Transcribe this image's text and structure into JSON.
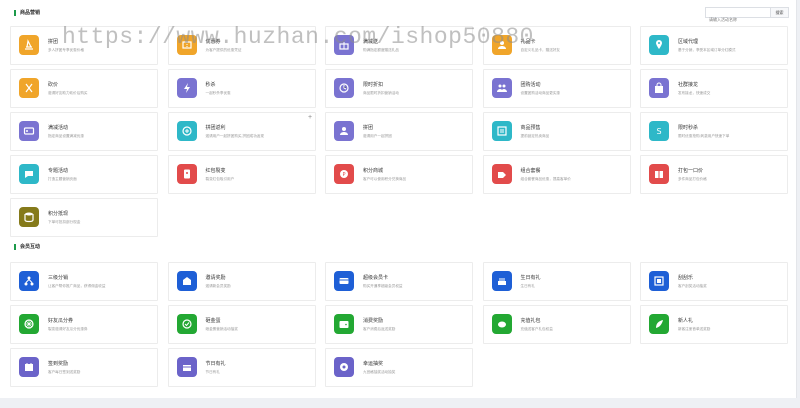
{
  "sections": {
    "marketing_title": "商品营销",
    "member_title": "会员互动"
  },
  "search": {
    "placeholder": "请输入活动名称",
    "button_label": "搜索"
  },
  "watermark": "https://www.huzhan.com/ishop50880",
  "marketing_items": [
    {
      "name": "拼团",
      "desc": "多人拼团专享优惠价格",
      "color": "#f0a52a",
      "icon": "stack-icon"
    },
    {
      "name": "优惠券",
      "desc": "为客户提供的优惠凭证",
      "color": "#f0a52a",
      "icon": "coupon-icon"
    },
    {
      "name": "满减送",
      "desc": "购满指定额度赠送礼品",
      "color": "#7a73d1",
      "icon": "gift-icon"
    },
    {
      "name": "礼品卡",
      "desc": "自定义礼品卡，赠送好友",
      "color": "#f0a52a",
      "icon": "card-icon"
    },
    {
      "name": "区域代理",
      "desc": "基于分销，享受本区域订单分红模式",
      "color": "#2eb8c8",
      "icon": "location-icon"
    },
    {
      "name": "砍价",
      "desc": "邀请好友助力砍价后购买",
      "color": "#f0a52a",
      "icon": "cut-icon"
    },
    {
      "name": "秒杀",
      "desc": "一起秒杀享优惠",
      "color": "#7a73d1",
      "icon": "lightning-icon"
    },
    {
      "name": "限时折扣",
      "desc": "商品限时折扣营销活动",
      "color": "#7a73d1",
      "icon": "clock-icon"
    },
    {
      "name": "团购活动",
      "desc": "设置团购活动商品更实惠",
      "color": "#7a73d1",
      "icon": "group-icon"
    },
    {
      "name": "社群接龙",
      "desc": "发布接龙，快速成交",
      "color": "#7a73d1",
      "icon": "bag-icon"
    },
    {
      "name": "满减活动",
      "desc": "指定商品设置满减优惠",
      "color": "#7a73d1",
      "icon": "ticket-icon"
    },
    {
      "name": "拼团返利",
      "desc": "邀请用户一起拼团购买,拼团成功返现",
      "color": "#2eb8c8",
      "icon": "refund-icon"
    },
    {
      "name": "拼团",
      "desc": "邀请用户一起拼团",
      "color": "#7a73d1",
      "icon": "people-icon"
    },
    {
      "name": "商品预售",
      "desc": "提前锁定热卖商品",
      "color": "#2eb8c8",
      "icon": "presale-icon"
    },
    {
      "name": "限时秒杀",
      "desc": "限时优惠抢购,刺激用户快速下单",
      "color": "#2eb8c8",
      "icon": "second-icon"
    },
    {
      "name": "专题活动",
      "desc": "打造主题营销页面",
      "color": "#2eb8c8",
      "icon": "topic-icon"
    },
    {
      "name": "红包裂变",
      "desc": "裂变红包吸引用户",
      "color": "#e24b4b",
      "icon": "redpacket-icon"
    },
    {
      "name": "积分商城",
      "desc": "客户可以使用积分兑换商品",
      "color": "#e24b4b",
      "icon": "points-icon"
    },
    {
      "name": "组合套餐",
      "desc": "组合套餐商品优惠，提高客单价",
      "color": "#e24b4b",
      "icon": "combo-icon"
    },
    {
      "name": "打包一口价",
      "desc": "多件商品打包价格",
      "color": "#e24b4b",
      "icon": "package-icon"
    },
    {
      "name": "积分抵现",
      "desc": "下单可抵扣部分现金",
      "color": "#857a1a",
      "icon": "database-icon"
    }
  ],
  "member_items": [
    {
      "name": "三级分销",
      "desc": "让客户帮你推广商品，获得佣金收益",
      "color": "#1e5fd6",
      "icon": "network-icon"
    },
    {
      "name": "邀请奖励",
      "desc": "邀请新会员奖励",
      "color": "#1e5fd6",
      "icon": "invite-icon"
    },
    {
      "name": "超级会员卡",
      "desc": "购买开通享超级会员权益",
      "color": "#1e5fd6",
      "icon": "vipcard-icon"
    },
    {
      "name": "生日有礼",
      "desc": "生日有礼",
      "color": "#1e5fd6",
      "icon": "cake-icon"
    },
    {
      "name": "刮刮乐",
      "desc": "客户刮奖活动抽奖",
      "color": "#1e5fd6",
      "icon": "scratch-icon"
    },
    {
      "name": "好友瓜分券",
      "desc": "裂变邀请好友瓜分优惠券",
      "color": "#23a833",
      "icon": "wheel-icon"
    },
    {
      "name": "砸金蛋",
      "desc": "砸金蛋营销活动抽奖",
      "color": "#23a833",
      "icon": "egg-icon"
    },
    {
      "name": "消费奖励",
      "desc": "客户消费后返送奖励",
      "color": "#23a833",
      "icon": "wallet-icon"
    },
    {
      "name": "充值礼包",
      "desc": "充值送客户礼包权益",
      "color": "#23a833",
      "icon": "piggy-icon"
    },
    {
      "name": "新人礼",
      "desc": "新客注册首单送奖励",
      "color": "#23a833",
      "icon": "leaf-icon"
    },
    {
      "name": "签到奖励",
      "desc": "客户每日签到送奖励",
      "color": "#6b63c9",
      "icon": "calendar-icon"
    },
    {
      "name": "节日有礼",
      "desc": "节日有礼",
      "color": "#6b63c9",
      "icon": "festival-icon"
    },
    {
      "name": "幸运抽奖",
      "desc": "九宫格抽奖活动抽奖",
      "color": "#6b63c9",
      "icon": "lucky-icon"
    }
  ]
}
